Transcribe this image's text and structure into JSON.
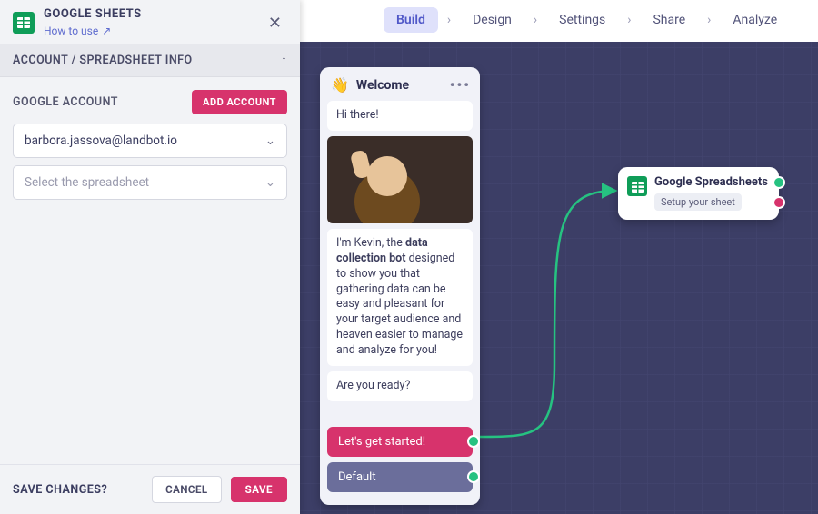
{
  "panel": {
    "title": "GOOGLE SHEETS",
    "how_to_use": "How to use",
    "section": "ACCOUNT / SPREADSHEET INFO",
    "account_label": "GOOGLE ACCOUNT",
    "add_account": "ADD ACCOUNT",
    "account_value": "barbora.jassova@landbot.io",
    "spreadsheet_placeholder": "Select the spreadsheet"
  },
  "footer": {
    "label": "SAVE CHANGES?",
    "cancel": "CANCEL",
    "save": "SAVE"
  },
  "nav": {
    "tabs": [
      "Build",
      "Design",
      "Settings",
      "Share",
      "Analyze"
    ],
    "active": "Build"
  },
  "welcome": {
    "title": "Welcome",
    "hi": "Hi there!",
    "intro_pre": "I'm Kevin, the ",
    "intro_bold": "data collection bot",
    "intro_post": " designed to show you that gathering data can be easy and pleasant for your target audience and heaven easier to manage and analyze for you!",
    "ready": "Are you ready?",
    "opt1": "Let's get started!",
    "opt2": "Default"
  },
  "node": {
    "title": "Google Spreadsheets",
    "subtitle": "Setup your sheet"
  },
  "colors": {
    "accent_pink": "#d7336c",
    "accent_green": "#26c281",
    "canvas": "#3c3e66"
  }
}
